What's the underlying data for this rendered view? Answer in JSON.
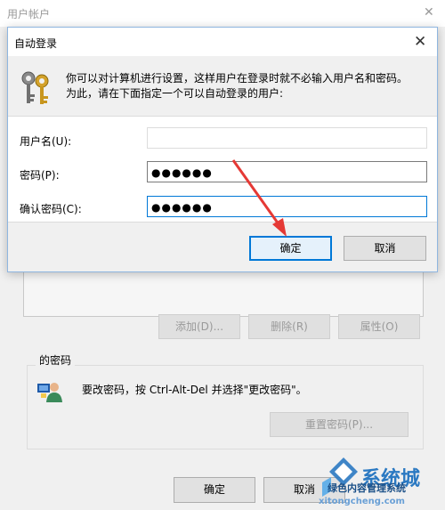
{
  "background_window": {
    "title": "用户帐户",
    "close_glyph": "✕",
    "buttons": {
      "add": "添加(D)...",
      "remove": "删除(R)",
      "properties": "属性(O)"
    },
    "password_group": {
      "label": "的密码",
      "icon": "user-password-icon",
      "text": "要改密码，按 Ctrl-Alt-Del 并选择\"更改密码\"。",
      "reset_button": "重置密码(P)..."
    },
    "ok_button": "确定",
    "cancel_button": "取消"
  },
  "dialog": {
    "title": "自动登录",
    "close_glyph": "✕",
    "icon": "keys-icon",
    "description_line1": "你可以对计算机进行设置，这样用户在登录时就不必输入用户名和密码。",
    "description_line2": "为此，请在下面指定一个可以自动登录的用户:",
    "fields": {
      "username_label": "用户名(U):",
      "username_value": "",
      "password_label": "密码(P):",
      "password_value": "●●●●●●",
      "confirm_label": "确认密码(C):",
      "confirm_value": "●●●●●●"
    },
    "ok_button": "确定",
    "cancel_button": "取消"
  },
  "annotation": {
    "arrow_color": "#e53935"
  },
  "watermark": {
    "brand": "系统城",
    "tagline": "绿色内容管理系统",
    "url": "xitongcheng.com"
  },
  "colors": {
    "accent": "#0078d7",
    "window_bg": "#f0f0f0"
  }
}
